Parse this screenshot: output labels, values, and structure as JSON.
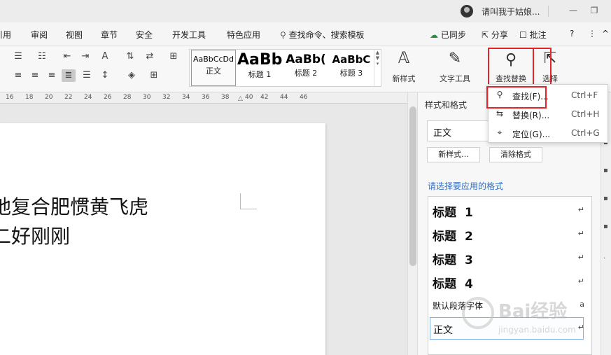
{
  "titlebar": {
    "user_name": "请叫我于姑娘...",
    "minimize": "—",
    "restore": "❐"
  },
  "menu": {
    "tabs": [
      "引用",
      "审阅",
      "视图",
      "章节",
      "安全",
      "开发工具",
      "特色应用"
    ],
    "search_label": "查找命令、搜索模板",
    "sync_label": "已同步",
    "share_label": "分享",
    "review_label": "批注",
    "help": "?",
    "more": "⋮",
    "collapse": "^"
  },
  "ribbon": {
    "style_cards": [
      {
        "sample": "AaBbCcDd",
        "label": "正文"
      },
      {
        "sample": "AaBb",
        "label": "标题 1"
      },
      {
        "sample": "AaBb(",
        "label": "标题 2"
      },
      {
        "sample": "AaBbC",
        "label": "标题 3"
      }
    ],
    "new_style": "新样式",
    "text_tools": "文字工具",
    "find_replace": "查找替换",
    "select": "选择"
  },
  "ruler": {
    "ticks": [
      "16",
      "18",
      "20",
      "22",
      "24",
      "26",
      "28",
      "30",
      "32",
      "34",
      "36",
      "38",
      "40",
      "42",
      "44",
      "46"
    ]
  },
  "document": {
    "line1": "地复合肥惯黄飞虎",
    "line2": "二好刚刚"
  },
  "style_panel": {
    "title": "样式和格式",
    "current_style": "正文",
    "new_style_btn": "新样式...",
    "clear_format_btn": "清除格式",
    "apply_hint": "请选择要应用的格式",
    "items": [
      {
        "name": "标题",
        "num": "1",
        "mark": "↵"
      },
      {
        "name": "标题",
        "num": "2",
        "mark": "↵"
      },
      {
        "name": "标题",
        "num": "3",
        "mark": "↵"
      },
      {
        "name": "标题",
        "num": "4",
        "mark": "↵"
      },
      {
        "name": "默认段落字体",
        "num": "",
        "mark": "a"
      },
      {
        "name": "正文",
        "num": "",
        "mark": "↵"
      }
    ]
  },
  "dropdown": {
    "items": [
      {
        "icon": "search-icon",
        "label": "查找(F)...",
        "shortcut": "Ctrl+F"
      },
      {
        "icon": "replace-icon",
        "label": "替换(R)...",
        "shortcut": "Ctrl+H"
      },
      {
        "icon": "goto-icon",
        "label": "定位(G)...",
        "shortcut": "Ctrl+G"
      }
    ]
  },
  "watermark": {
    "text": "Bai经验",
    "url": "jingyan.baidu.com"
  },
  "colors": {
    "highlight_border": "#e0262b",
    "hint_text": "#2f6fc4"
  }
}
